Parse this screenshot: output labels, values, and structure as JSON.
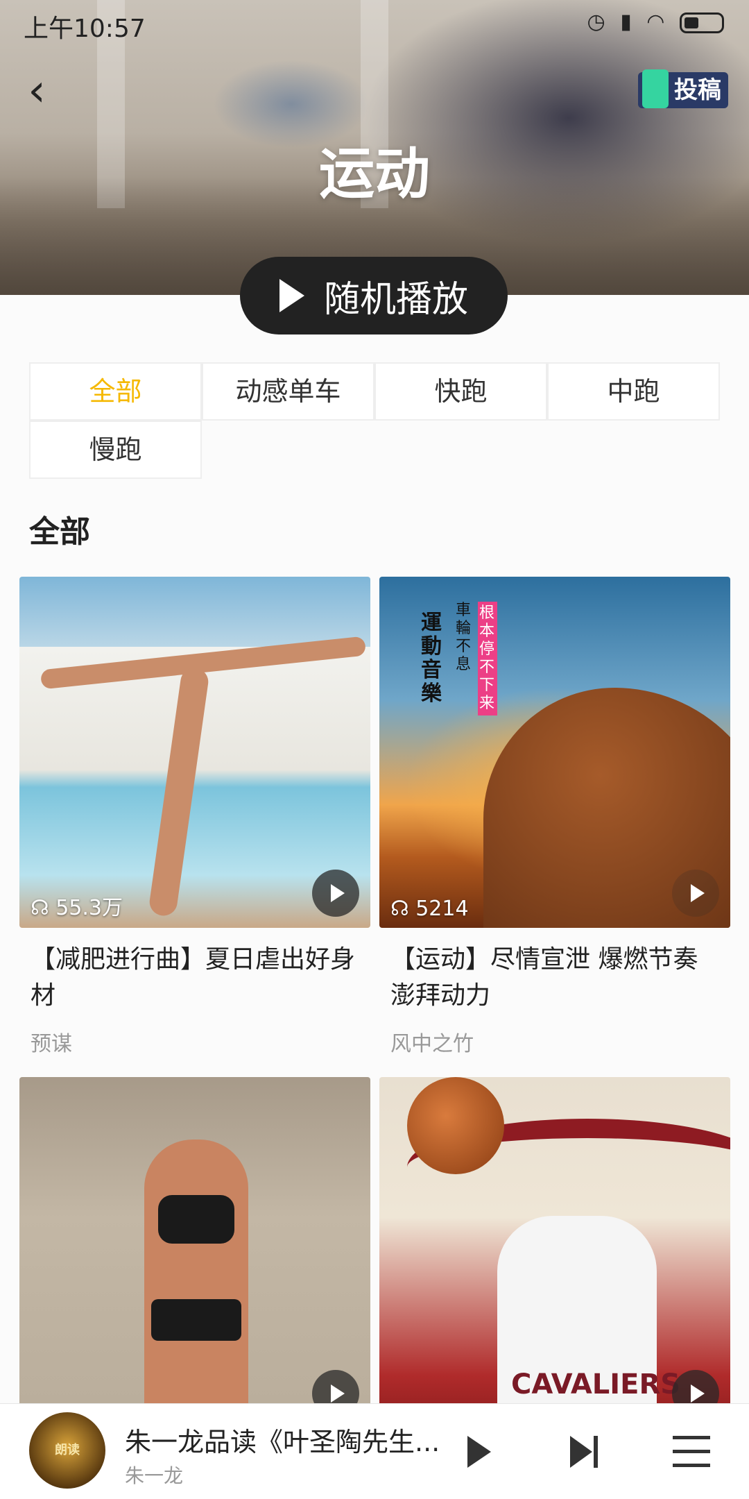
{
  "status_bar": {
    "time": "上午10:57",
    "icons": [
      "alarm-icon",
      "signal-icon",
      "wifi-icon",
      "battery-icon"
    ]
  },
  "header": {
    "title": "运动",
    "submit_label": "投稿",
    "shuffle_label": "随机播放"
  },
  "filters": {
    "active_index": 0,
    "items": [
      "全部",
      "动感单车",
      "快跑",
      "中跑",
      "慢跑"
    ]
  },
  "section": {
    "title": "全部"
  },
  "cards": [
    {
      "title": "【减肥进行曲】夏日虐出好身材",
      "author": "预谋",
      "play_count": "55.3万"
    },
    {
      "title": "【运动】尽情宣泄 爆燃节奏 澎拜动力",
      "author": "风中之竹",
      "play_count": "5214",
      "thumb_text_main": "運動音樂",
      "thumb_text_side": "車輪不息",
      "thumb_text_tag": "根本停不下来"
    },
    {
      "title": "",
      "author": "",
      "play_count": ""
    },
    {
      "title": "",
      "author": "",
      "play_count": "",
      "thumb_text": "CAVALIERS"
    }
  ],
  "mini_player": {
    "title": "朱一龙品读《叶圣陶先生...",
    "author": "朱一龙",
    "cover_text": "朗读"
  },
  "colors": {
    "accent": "#f5b800",
    "shuffle_bg": "#222222"
  }
}
